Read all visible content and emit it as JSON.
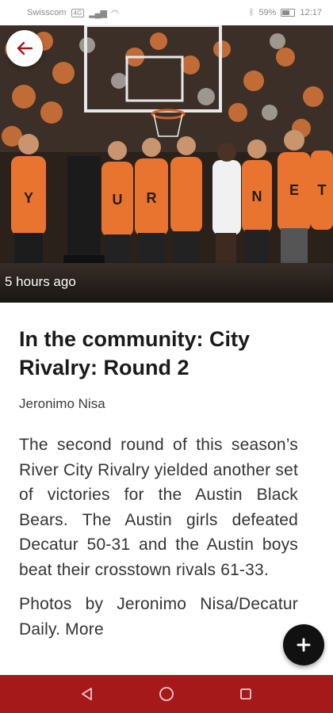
{
  "status_bar": {
    "carrier": "Swisscom",
    "carrier_badge": "4G",
    "signal_icon": "signal-bars-icon",
    "wifi_icon": "wifi-icon",
    "bluetooth_icon": "bluetooth-icon",
    "battery": "59%",
    "time": "12:17"
  },
  "hero": {
    "timestamp": "5 hours ago",
    "back_icon": "back-arrow-icon",
    "signs": [
      "Y",
      "U",
      "R",
      "E",
      "N",
      "T"
    ]
  },
  "article": {
    "headline": "In the community: City Rivalry: Round 2",
    "byline": "Jeronimo Nisa",
    "paragraph_1": "The second round of this season’s River City Rivalry yielded another set of victories for the Austin Black Bears. The Austin girls defeated Decatur 50-31 and the Austin boys beat their crosstown rivals 61-33.",
    "paragraph_2": "Photos by Jeronimo Nisa/Decatur Daily. More"
  },
  "fab": {
    "icon": "plus-icon"
  },
  "nav_bar": {
    "back_icon": "nav-back-triangle-icon",
    "home_icon": "nav-home-circle-icon",
    "recents_icon": "nav-recents-square-icon"
  },
  "colors": {
    "accent": "#a6191b",
    "fab": "#111111",
    "crowd_orange": "#e8742f"
  }
}
